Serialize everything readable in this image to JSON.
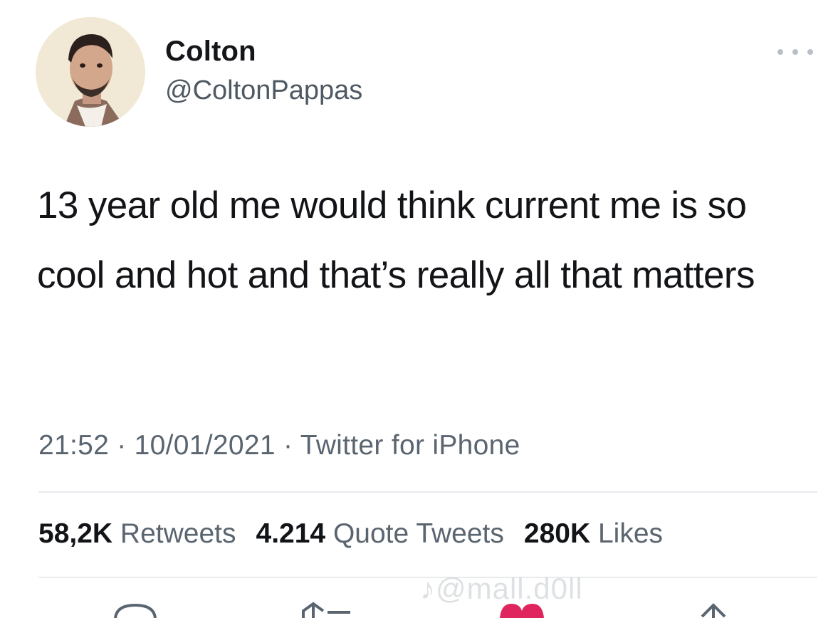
{
  "tweet": {
    "author_name": "Colton",
    "author_handle": "@ColtonPappas",
    "text": "13 year old me would think current me is so cool and hot and that’s really all that matters",
    "time": "21:52",
    "date": "10/01/2021",
    "source": "Twitter for iPhone",
    "separator": " · "
  },
  "stats": {
    "retweets_count": "58,2K",
    "retweets_label": "Retweets",
    "quotes_count": "4.214",
    "quotes_label": "Quote Tweets",
    "likes_count": "280K",
    "likes_label": "Likes"
  },
  "watermark": "♪@mall.d0ll",
  "icons": {
    "more": "more-options-icon",
    "reply": "reply-icon",
    "retweet": "retweet-icon",
    "like": "heart-icon",
    "share": "share-icon"
  },
  "colors": {
    "text": "#141619",
    "secondary": "#5a6570",
    "like": "#e0245e"
  }
}
